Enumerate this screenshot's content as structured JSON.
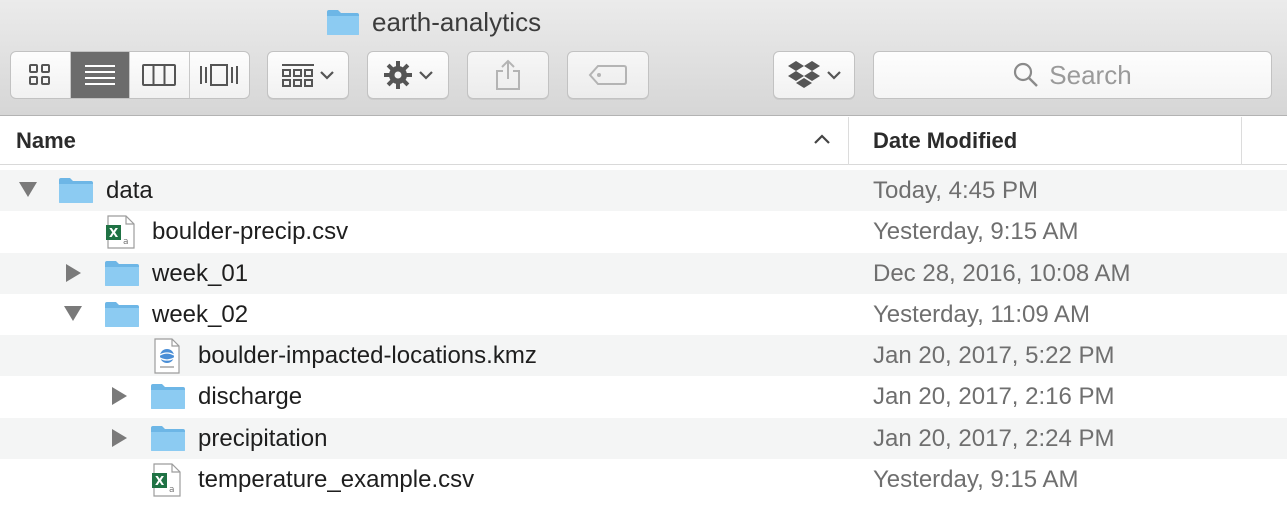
{
  "window": {
    "title": "earth-analytics",
    "title_icon": "folder-icon"
  },
  "toolbar": {
    "view_modes": [
      "icon-view-icon",
      "list-view-icon",
      "column-view-icon",
      "cover-flow-icon"
    ],
    "active_view": "list",
    "search_placeholder": "Search"
  },
  "columns": {
    "name": "Name",
    "date_modified": "Date Modified",
    "sort": "ascending"
  },
  "rows": [
    {
      "name": "data",
      "date": "Today, 4:45 PM",
      "type": "folder",
      "expanded": true,
      "level": 0
    },
    {
      "name": "boulder-precip.csv",
      "date": "Yesterday, 9:15 AM",
      "type": "csv",
      "level": 1
    },
    {
      "name": "week_01",
      "date": "Dec 28, 2016, 10:08 AM",
      "type": "folder",
      "expanded": false,
      "level": 1
    },
    {
      "name": "week_02",
      "date": "Yesterday, 11:09 AM",
      "type": "folder",
      "expanded": true,
      "level": 1
    },
    {
      "name": "boulder-impacted-locations.kmz",
      "date": "Jan 20, 2017, 5:22 PM",
      "type": "kmz",
      "level": 2
    },
    {
      "name": "discharge",
      "date": "Jan 20, 2017, 2:16 PM",
      "type": "folder",
      "expanded": false,
      "level": 2
    },
    {
      "name": "precipitation",
      "date": "Jan 20, 2017, 2:24 PM",
      "type": "folder",
      "expanded": false,
      "level": 2
    },
    {
      "name": "temperature_example.csv",
      "date": "Yesterday, 9:15 AM",
      "type": "csv",
      "level": 2
    }
  ],
  "colors": {
    "folder": "#8ccbf2",
    "folder_dark": "#6db6e6",
    "excel_green": "#1f7244"
  }
}
